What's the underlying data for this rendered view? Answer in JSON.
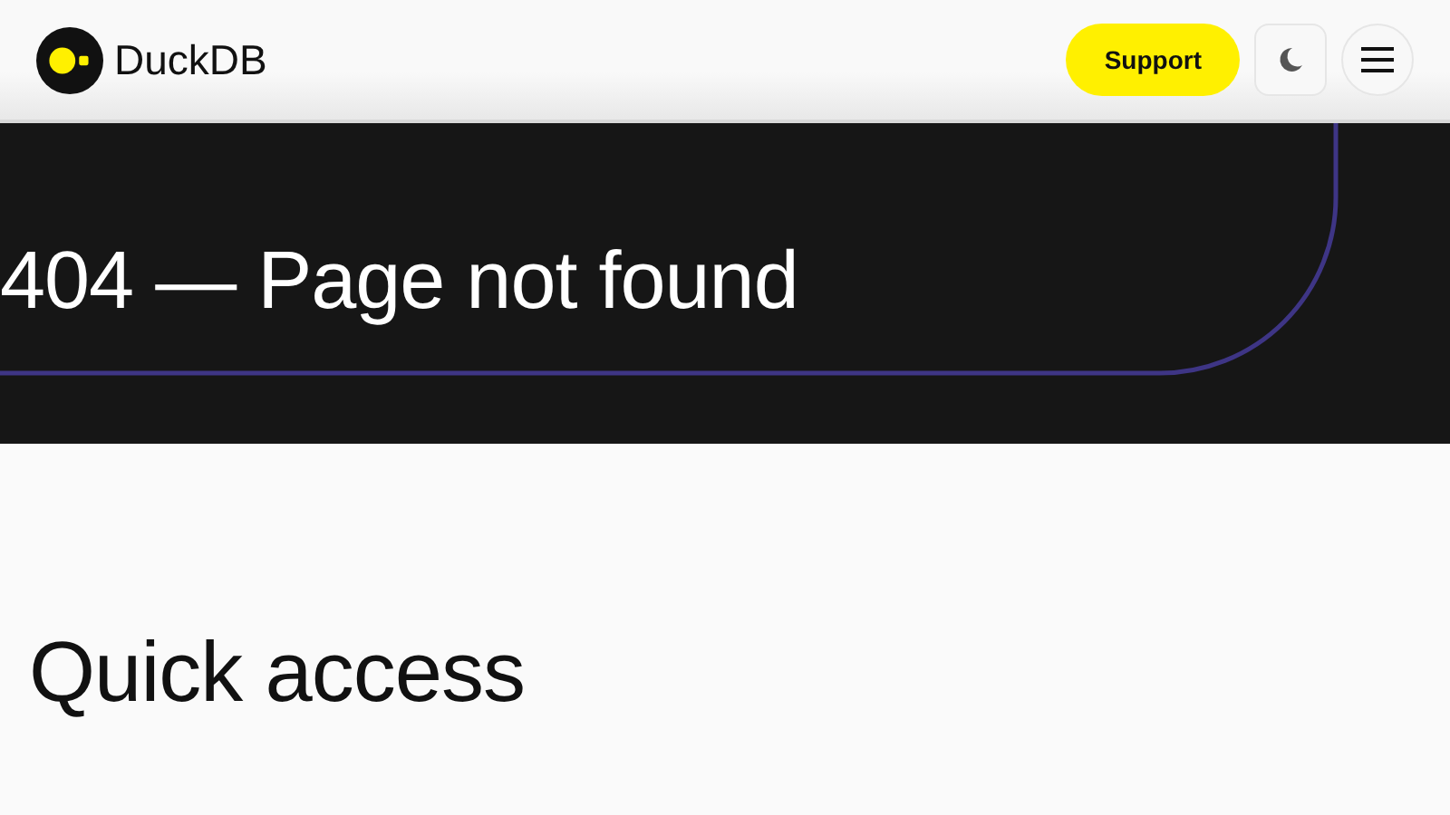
{
  "header": {
    "logo_text": "DuckDB",
    "support_button": "Support"
  },
  "hero": {
    "title": "404 — Page not found"
  },
  "content": {
    "heading": "Quick access"
  }
}
